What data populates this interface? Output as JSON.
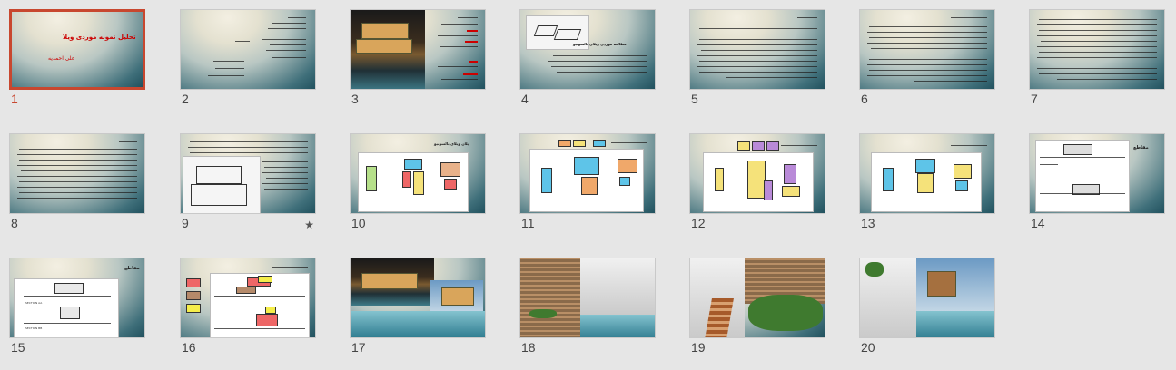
{
  "slides": [
    {
      "number": "1",
      "title": "تحلیل نمونه موردی ویلا",
      "subtitle": "علی احمدیه"
    },
    {
      "number": "2"
    },
    {
      "number": "3"
    },
    {
      "number": "4",
      "heading": "مطالعه موردی ویلای بالسونیو"
    },
    {
      "number": "5"
    },
    {
      "number": "6"
    },
    {
      "number": "7"
    },
    {
      "number": "8"
    },
    {
      "number": "9"
    },
    {
      "number": "10",
      "heading": "پلان ویلای بالسونیو"
    },
    {
      "number": "11"
    },
    {
      "number": "12"
    },
    {
      "number": "13"
    },
    {
      "number": "14",
      "heading": "مقاطع"
    },
    {
      "number": "15",
      "heading": "مقاطع",
      "caption_a": "SECTION AA",
      "caption_b": "SECTION BB"
    },
    {
      "number": "16"
    },
    {
      "number": "17"
    },
    {
      "number": "18"
    },
    {
      "number": "19"
    },
    {
      "number": "20"
    }
  ],
  "selected_slide": "1",
  "star_symbol": "★",
  "colors": {
    "selection": "#c8472f",
    "background": "#e6e6e6"
  }
}
